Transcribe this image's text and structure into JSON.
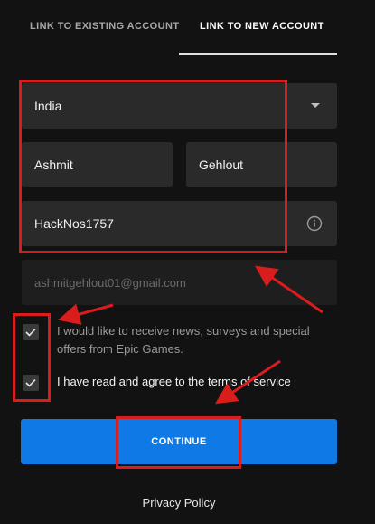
{
  "tabs": [
    {
      "label": "LINK TO EXISTING ACCOUNT",
      "active": false
    },
    {
      "label": "LINK TO NEW ACCOUNT",
      "active": true
    }
  ],
  "form": {
    "country": {
      "value": "India",
      "icon": "chevron-down-icon"
    },
    "first_name": {
      "value": "Ashmit"
    },
    "last_name": {
      "value": "Gehlout"
    },
    "display_name": {
      "value": "HackNos1757",
      "icon": "info-icon"
    },
    "email": {
      "value": "ashmitgehlout01@gmail.com",
      "disabled": true
    }
  },
  "checkboxes": [
    {
      "label": "I would like to receive news, surveys and special offers from Epic Games.",
      "checked": true
    },
    {
      "label_prefix": "I have read and agree to the ",
      "link_text": "terms of service",
      "checked": true
    }
  ],
  "continue_label": "CONTINUE",
  "privacy_label": "Privacy Policy",
  "colors": {
    "background": "#121212",
    "field": "#2a2a2a",
    "primary_button": "#0f7ae5",
    "annotation": "#d91c1c"
  }
}
